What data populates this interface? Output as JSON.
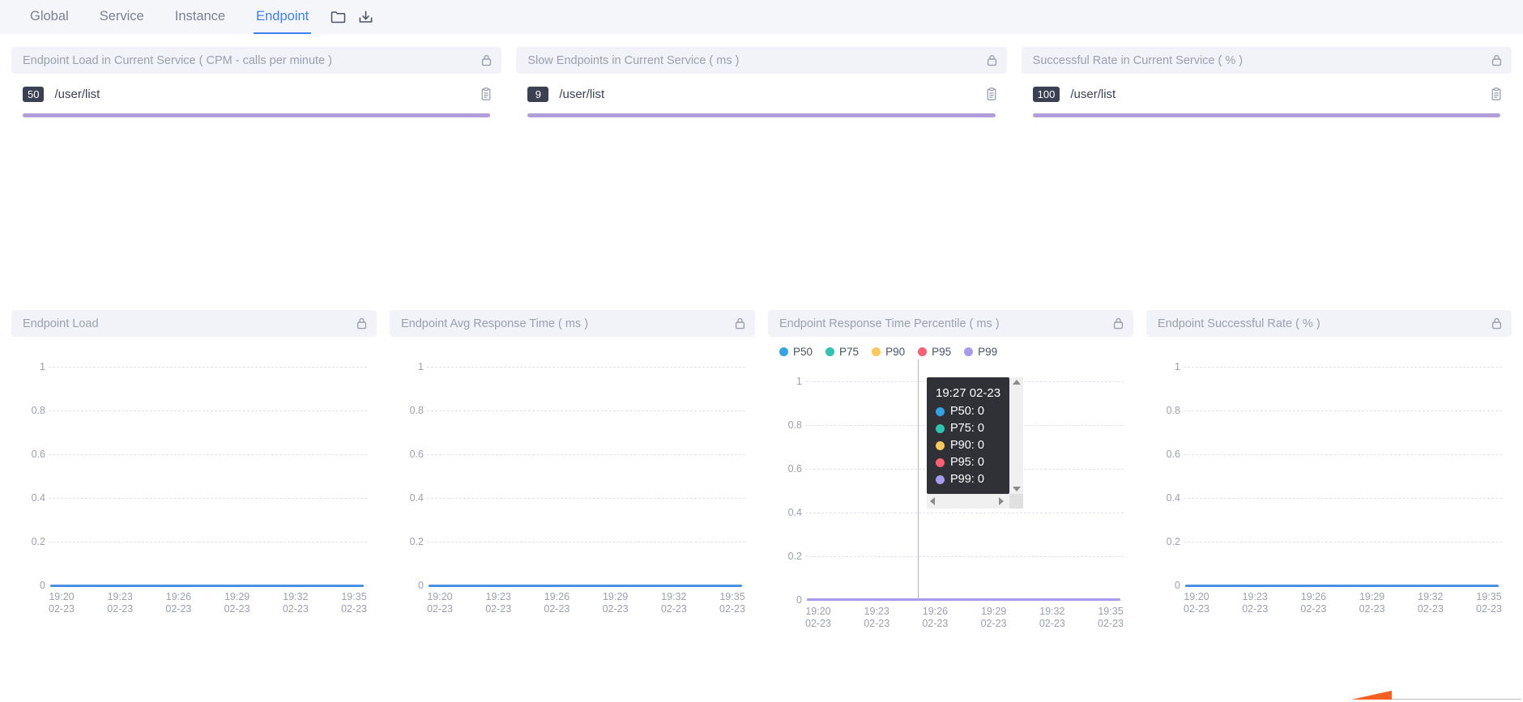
{
  "nav": {
    "tabs": [
      {
        "label": "Global",
        "active": false
      },
      {
        "label": "Service",
        "active": false
      },
      {
        "label": "Instance",
        "active": false
      },
      {
        "label": "Endpoint",
        "active": true
      }
    ],
    "icons": [
      {
        "name": "folder-icon"
      },
      {
        "name": "download-icon"
      }
    ],
    "active_color": "#3f7ef4"
  },
  "cards": [
    {
      "title": "Endpoint Load in Current Service ( CPM - calls per minute )",
      "badge": "50",
      "name": "/user/list",
      "bar_color": "#b39ddb",
      "bar_percent": 100
    },
    {
      "title": "Slow Endpoints in Current Service ( ms )",
      "badge": "9",
      "name": "/user/list",
      "bar_color": "#b39ddb",
      "bar_percent": 100
    },
    {
      "title": "Successful Rate in Current Service ( % )",
      "badge": "100",
      "name": "/user/list",
      "bar_color": "#b39ddb",
      "bar_percent": 100
    }
  ],
  "charts": [
    {
      "title": "Endpoint Load"
    },
    {
      "title": "Endpoint Avg Response Time ( ms )"
    },
    {
      "title": "Endpoint Response Time Percentile ( ms )"
    },
    {
      "title": "Endpoint Successful Rate ( % )"
    }
  ],
  "legend": [
    {
      "label": "P50",
      "color": "#33a3e5"
    },
    {
      "label": "P75",
      "color": "#2fc3b1"
    },
    {
      "label": "P90",
      "color": "#fbc95b"
    },
    {
      "label": "P95",
      "color": "#f85f73"
    },
    {
      "label": "P99",
      "color": "#a79bef"
    }
  ],
  "tooltip": {
    "time": "19:27 02-23",
    "rows": [
      {
        "label": "P50: 0",
        "color": "#33a3e5"
      },
      {
        "label": "P75: 0",
        "color": "#2fc3b1"
      },
      {
        "label": "P90: 0",
        "color": "#fbc95b"
      },
      {
        "label": "P95: 0",
        "color": "#f85f73"
      },
      {
        "label": "P99: 0",
        "color": "#a79bef"
      }
    ]
  },
  "chart_data": [
    {
      "type": "line",
      "title": "Endpoint Load",
      "xlabel": "",
      "ylabel": "",
      "ylim": [
        0,
        1
      ],
      "yticks": [
        "1",
        "0.8",
        "0.6",
        "0.4",
        "0.2",
        "0"
      ],
      "grid": true,
      "legend_position": "none",
      "x": [
        "19:20 02-23",
        "19:23 02-23",
        "19:26 02-23",
        "19:29 02-23",
        "19:32 02-23",
        "19:35 02-23"
      ],
      "series": [
        {
          "name": "Endpoint Load",
          "color": "#4a90e2",
          "values": [
            0,
            0,
            0,
            0,
            0,
            0
          ]
        }
      ]
    },
    {
      "type": "line",
      "title": "Endpoint Avg Response Time ( ms )",
      "xlabel": "",
      "ylabel": "",
      "ylim": [
        0,
        1
      ],
      "yticks": [
        "1",
        "0.8",
        "0.6",
        "0.4",
        "0.2",
        "0"
      ],
      "grid": true,
      "legend_position": "none",
      "x": [
        "19:20 02-23",
        "19:23 02-23",
        "19:26 02-23",
        "19:29 02-23",
        "19:32 02-23",
        "19:35 02-23"
      ],
      "series": [
        {
          "name": "Endpoint Avg Response Time",
          "color": "#4a90e2",
          "values": [
            0,
            0,
            0,
            0,
            0,
            0
          ]
        }
      ]
    },
    {
      "type": "line",
      "title": "Endpoint Response Time Percentile ( ms )",
      "xlabel": "",
      "ylabel": "",
      "ylim": [
        0,
        1
      ],
      "yticks": [
        "1",
        "0.8",
        "0.6",
        "0.4",
        "0.2",
        "0"
      ],
      "grid": true,
      "legend_position": "top-left",
      "x": [
        "19:20 02-23",
        "19:23 02-23",
        "19:26 02-23",
        "19:29 02-23",
        "19:32 02-23",
        "19:35 02-23"
      ],
      "series": [
        {
          "name": "P50",
          "color": "#33a3e5",
          "values": [
            0,
            0,
            0,
            0,
            0,
            0
          ]
        },
        {
          "name": "P75",
          "color": "#2fc3b1",
          "values": [
            0,
            0,
            0,
            0,
            0,
            0
          ]
        },
        {
          "name": "P90",
          "color": "#fbc95b",
          "values": [
            0,
            0,
            0,
            0,
            0,
            0
          ]
        },
        {
          "name": "P95",
          "color": "#f85f73",
          "values": [
            0,
            0,
            0,
            0,
            0,
            0
          ]
        },
        {
          "name": "P99",
          "color": "#a79bef",
          "values": [
            0,
            0,
            0,
            0,
            0,
            0
          ]
        }
      ],
      "hover": {
        "x": "19:27 02-23",
        "values": {
          "P50": 0,
          "P75": 0,
          "P90": 0,
          "P95": 0,
          "P99": 0
        }
      }
    },
    {
      "type": "line",
      "title": "Endpoint Successful Rate ( % )",
      "xlabel": "",
      "ylabel": "",
      "ylim": [
        0,
        1
      ],
      "yticks": [
        "1",
        "0.8",
        "0.6",
        "0.4",
        "0.2",
        "0"
      ],
      "grid": true,
      "legend_position": "none",
      "x": [
        "19:20 02-23",
        "19:23 02-23",
        "19:26 02-23",
        "19:29 02-23",
        "19:32 02-23",
        "19:35 02-23"
      ],
      "series": [
        {
          "name": "Endpoint Successful Rate",
          "color": "#4a90e2",
          "values": [
            0,
            0,
            0,
            0,
            0,
            0
          ]
        }
      ]
    }
  ]
}
